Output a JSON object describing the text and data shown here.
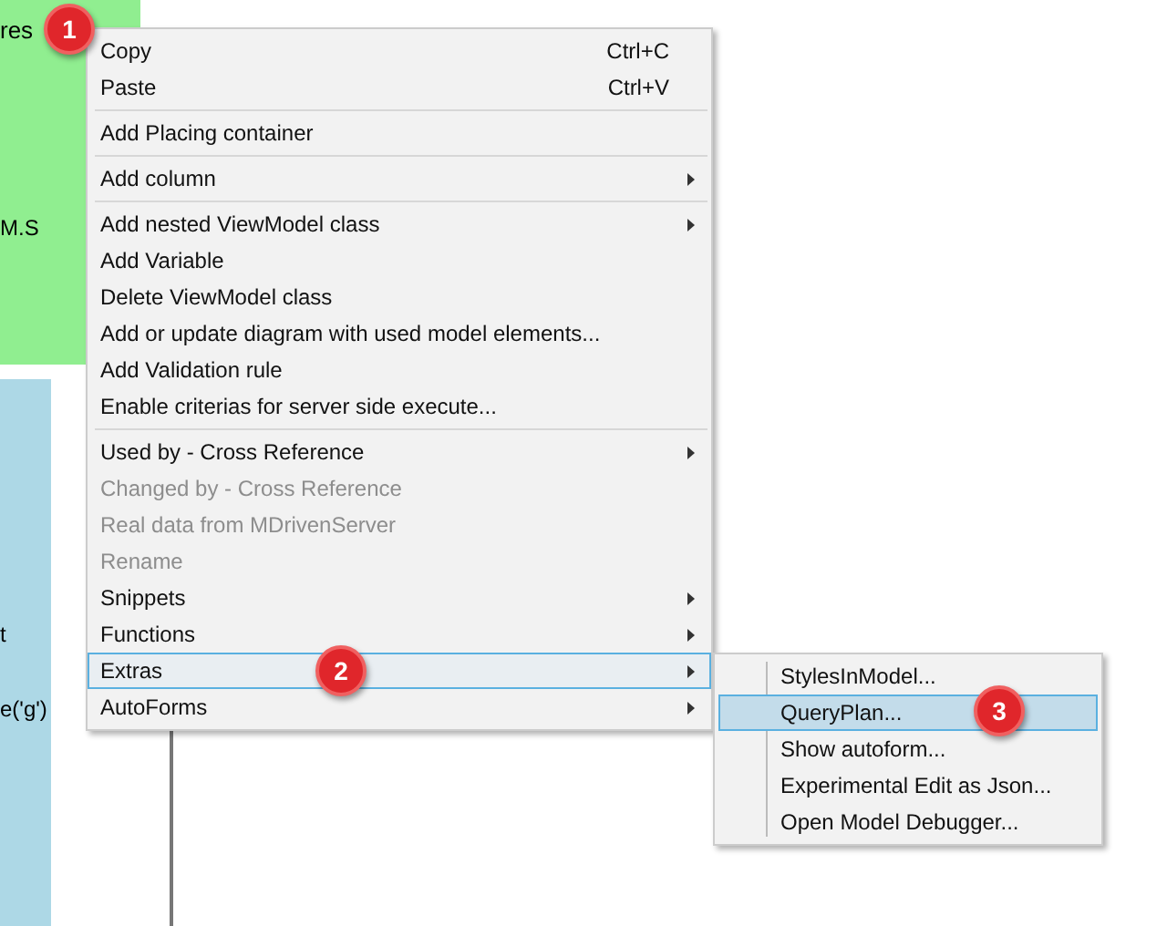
{
  "background": {
    "green_panel": {
      "title": "res",
      "line": "M.S"
    },
    "blue_panel": {
      "lines": [
        "t",
        "e('g')"
      ]
    }
  },
  "context_menu": {
    "items": [
      {
        "kind": "item",
        "label": "Copy",
        "shortcut": "Ctrl+C",
        "submenu": false,
        "disabled": false,
        "selected": false
      },
      {
        "kind": "item",
        "label": "Paste",
        "shortcut": "Ctrl+V",
        "submenu": false,
        "disabled": false,
        "selected": false
      },
      {
        "kind": "separator"
      },
      {
        "kind": "item",
        "label": "Add Placing container",
        "submenu": false,
        "disabled": false,
        "selected": false
      },
      {
        "kind": "separator"
      },
      {
        "kind": "item",
        "label": "Add column",
        "submenu": true,
        "disabled": false,
        "selected": false
      },
      {
        "kind": "separator"
      },
      {
        "kind": "item",
        "label": "Add nested ViewModel class",
        "submenu": true,
        "disabled": false,
        "selected": false
      },
      {
        "kind": "item",
        "label": "Add Variable",
        "submenu": false,
        "disabled": false,
        "selected": false
      },
      {
        "kind": "item",
        "label": "Delete ViewModel class",
        "submenu": false,
        "disabled": false,
        "selected": false
      },
      {
        "kind": "item",
        "label": "Add or update diagram with used model elements...",
        "submenu": false,
        "disabled": false,
        "selected": false
      },
      {
        "kind": "item",
        "label": "Add Validation rule",
        "submenu": false,
        "disabled": false,
        "selected": false
      },
      {
        "kind": "item",
        "label": "Enable criterias for server side execute...",
        "submenu": false,
        "disabled": false,
        "selected": false
      },
      {
        "kind": "separator"
      },
      {
        "kind": "item",
        "label": "Used by - Cross Reference",
        "submenu": true,
        "disabled": false,
        "selected": false
      },
      {
        "kind": "item",
        "label": "Changed by - Cross Reference",
        "submenu": false,
        "disabled": true,
        "selected": false
      },
      {
        "kind": "item",
        "label": "Real data from MDrivenServer",
        "submenu": false,
        "disabled": true,
        "selected": false
      },
      {
        "kind": "item",
        "label": "Rename",
        "submenu": false,
        "disabled": true,
        "selected": false
      },
      {
        "kind": "item",
        "label": "Snippets",
        "submenu": true,
        "disabled": false,
        "selected": false
      },
      {
        "kind": "item",
        "label": "Functions",
        "submenu": true,
        "disabled": false,
        "selected": false
      },
      {
        "kind": "item",
        "label": "Extras",
        "submenu": true,
        "disabled": false,
        "selected": true
      },
      {
        "kind": "item",
        "label": "AutoForms",
        "submenu": true,
        "disabled": false,
        "selected": false
      }
    ]
  },
  "submenu": {
    "items": [
      {
        "label": "StylesInModel...",
        "selected": false
      },
      {
        "label": "QueryPlan...",
        "selected": true
      },
      {
        "label": "Show autoform...",
        "selected": false
      },
      {
        "label": "Experimental Edit as Json...",
        "selected": false
      },
      {
        "label": "Open Model Debugger...",
        "selected": false
      }
    ]
  },
  "annotations": [
    "1",
    "2",
    "3"
  ]
}
